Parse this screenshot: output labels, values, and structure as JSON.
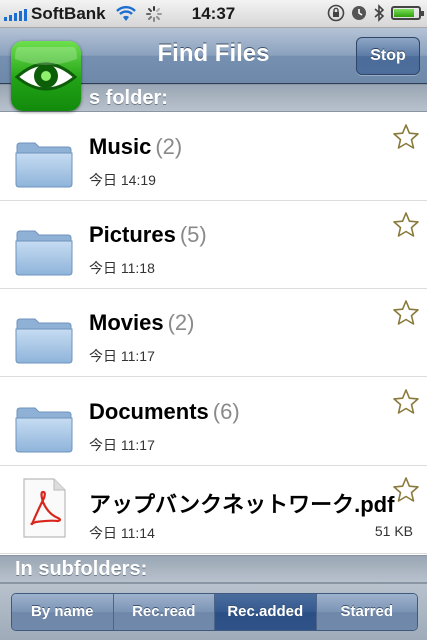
{
  "status_bar": {
    "carrier": "SoftBank",
    "time": "14:37",
    "battery_level": 0.85
  },
  "nav": {
    "title": "Find Files",
    "stop_label": "Stop"
  },
  "sections": {
    "this_folder": "s folder:",
    "subfolders": "In subfolders:"
  },
  "items": [
    {
      "name": "Music",
      "count": "(2)",
      "date": "今日 14:19",
      "size": "",
      "type": "folder-icon"
    },
    {
      "name": "Pictures",
      "count": "(5)",
      "date": "今日 11:18",
      "size": "",
      "type": "folder-icon"
    },
    {
      "name": "Movies",
      "count": "(2)",
      "date": "今日 11:17",
      "size": "",
      "type": "folder-icon"
    },
    {
      "name": "Documents",
      "count": "(6)",
      "date": "今日 11:17",
      "size": "",
      "type": "folder-icon"
    },
    {
      "name": "アップバンクネットワーク.pdf",
      "count": "",
      "date": "今日 11:14",
      "size": "51 KB",
      "type": "pdf-icon"
    }
  ],
  "sort_tabs": [
    {
      "label": "By name",
      "active": false
    },
    {
      "label": "Rec.read",
      "active": false
    },
    {
      "label": "Rec.added",
      "active": true
    },
    {
      "label": "Starred",
      "active": false
    }
  ],
  "colors": {
    "nav_blue": "#7590b1",
    "active_segment": "#2c4f85",
    "app_icon_green": "#22a316",
    "folder_blue": "#9cc0e4"
  }
}
